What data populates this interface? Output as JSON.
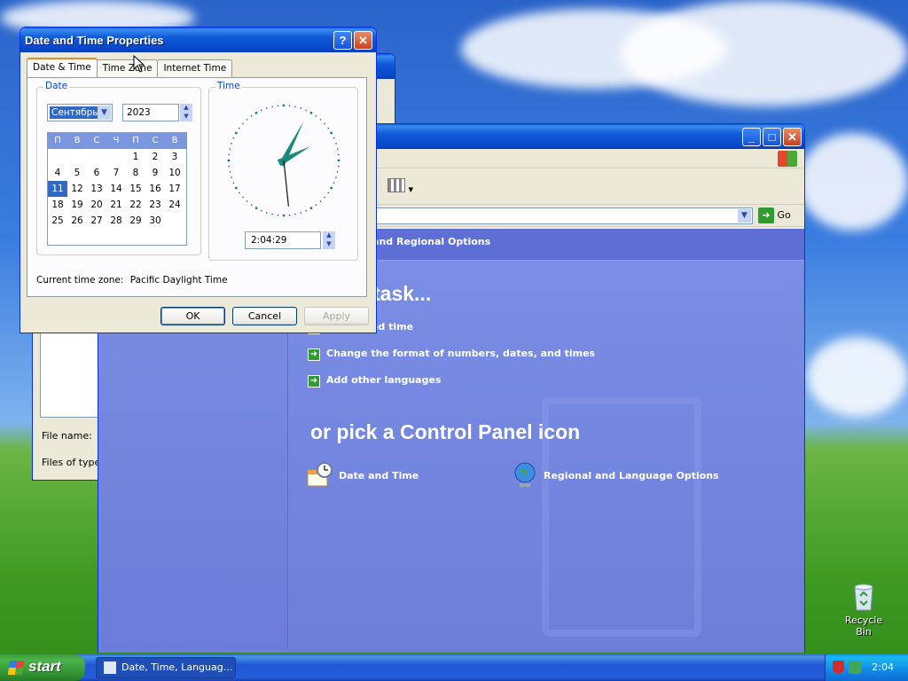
{
  "desktop": {
    "recycle_bin_label": "Recycle Bin"
  },
  "file_dialog": {
    "file_name_label": "File name:",
    "files_of_type_label": "Files of type:"
  },
  "control_panel": {
    "address_go": "Go",
    "category_header": "ne, Language, and Regional Options",
    "task_heading": "task...",
    "tasks": [
      "e date and time",
      "Change the format of numbers, dates, and times",
      "Add other languages"
    ],
    "icon_heading": "or pick a Control Panel icon",
    "icons": [
      {
        "label": "Date and Time",
        "icon": "calendar-clock-icon"
      },
      {
        "label": "Regional and Language Options",
        "icon": "globe-icon"
      }
    ]
  },
  "dialog": {
    "title": "Date and Time Properties",
    "tabs": [
      "Date & Time",
      "Time Zone",
      "Internet Time"
    ],
    "active_tab": 0,
    "date_group_label": "Date",
    "month_value": "Сентябрь",
    "year_value": "2023",
    "weekday_headers": [
      "П",
      "В",
      "С",
      "Ч",
      "П",
      "С",
      "В"
    ],
    "calendar_days": [
      "",
      "",
      "",
      "",
      "1",
      "2",
      "3",
      "4",
      "5",
      "6",
      "7",
      "8",
      "9",
      "10",
      "11",
      "12",
      "13",
      "14",
      "15",
      "16",
      "17",
      "18",
      "19",
      "20",
      "21",
      "22",
      "23",
      "24",
      "25",
      "26",
      "27",
      "28",
      "29",
      "30"
    ],
    "selected_day": "11",
    "time_group_label": "Time",
    "time_value": "2:04:29",
    "clock": {
      "hours": 2,
      "minutes": 4,
      "seconds": 29
    },
    "current_tz_label": "Current time zone:",
    "current_tz_value": "Pacific Daylight Time",
    "buttons": {
      "ok": "OK",
      "cancel": "Cancel",
      "apply": "Apply"
    }
  },
  "taskbar": {
    "start_label": "start",
    "task_label": "Date, Time, Languag...",
    "clock": "2:04"
  }
}
